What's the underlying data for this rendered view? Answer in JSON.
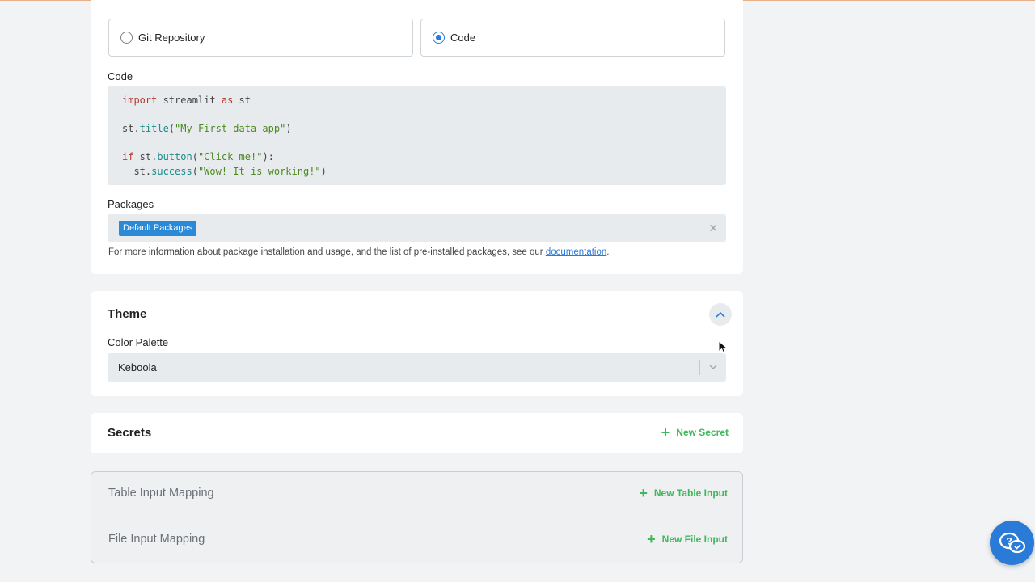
{
  "deployment": {
    "options": [
      {
        "label": "Git Repository",
        "selected": false
      },
      {
        "label": "Code",
        "selected": true
      }
    ],
    "code_label": "Code",
    "code_lines": {
      "l1_kw": "import",
      "l1_rest": " streamlit ",
      "l1_kw2": "as",
      "l1_end": " st",
      "l3_obj": "st.",
      "l3_fn": "title",
      "l3_str": "\"My First data app\"",
      "l5_kw": "if",
      "l5_obj": " st.",
      "l5_fn": "button",
      "l5_str": "\"Click me!\"",
      "l6_obj": "  st.",
      "l6_fn": "success",
      "l6_str": "\"Wow! It is working!\""
    },
    "packages_label": "Packages",
    "package_tag": "Default Packages",
    "packages_info": "For more information about package installation and usage, and the list of pre-installed packages, see our ",
    "packages_link": "documentation",
    "packages_info_end": "."
  },
  "theme": {
    "title": "Theme",
    "palette_label": "Color Palette",
    "palette_value": "Keboola"
  },
  "secrets": {
    "title": "Secrets",
    "add_label": "New Secret"
  },
  "mappings": {
    "table_title": "Table Input Mapping",
    "table_add": "New Table Input",
    "file_title": "File Input Mapping",
    "file_add": "New File Input"
  },
  "colors": {
    "accent": "#2a7bd7",
    "add_green": "#3fb85a",
    "tag_blue": "#2a8ad8"
  },
  "icons": [
    "radio-unchecked-icon",
    "radio-checked-icon",
    "close-icon",
    "chevron-up-icon",
    "chevron-down-icon",
    "plus-icon",
    "help-chat-icon",
    "mouse-cursor-icon"
  ]
}
